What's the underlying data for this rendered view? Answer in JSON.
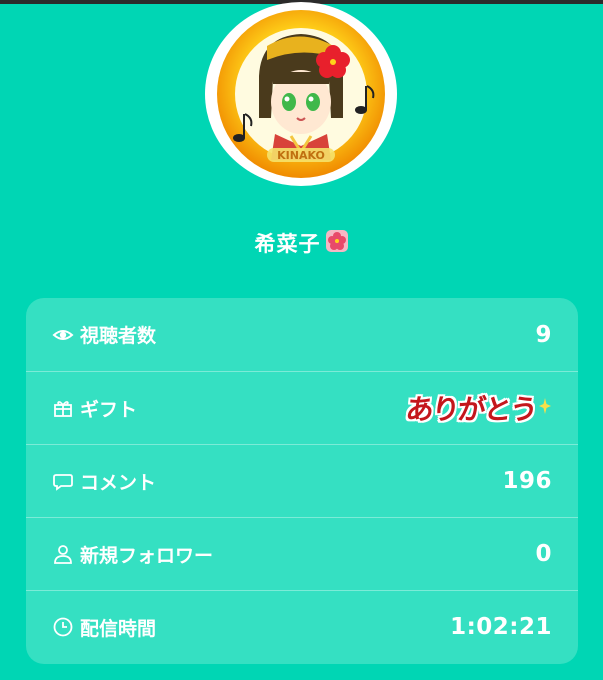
{
  "profile": {
    "name": "希菜子",
    "name_emoji": "hibiscus-icon",
    "avatar_icon": "character-avatar-icon"
  },
  "stats": [
    {
      "icon": "eye-icon",
      "label": "視聴者数",
      "value": "9"
    },
    {
      "icon": "gift-icon",
      "label": "ギフト",
      "value": "ありがとう"
    },
    {
      "icon": "speech-bubble-icon",
      "label": "コメント",
      "value": "196"
    },
    {
      "icon": "person-icon",
      "label": "新規フォロワー",
      "value": "0"
    },
    {
      "icon": "clock-icon",
      "label": "配信時間",
      "value": "1:02:21"
    }
  ],
  "colors": {
    "background": "#00d6b4",
    "card": "#35e0c2",
    "text": "#ffffff",
    "sticker": "#c4161c"
  }
}
